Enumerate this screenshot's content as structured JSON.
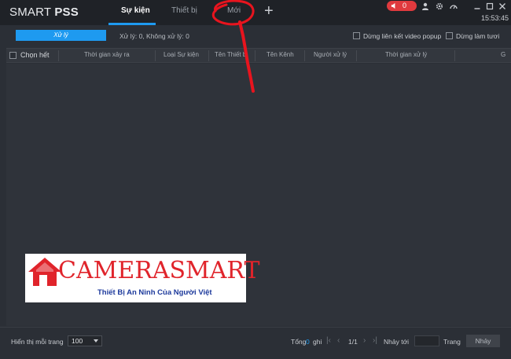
{
  "app": {
    "logo_light": "SMART ",
    "logo_bold": "PSS",
    "clock": "15:53:45",
    "alarm_count": "0"
  },
  "tabs": [
    {
      "label": "Sự kiện",
      "active": true
    },
    {
      "label": "Thiết bị",
      "active": false
    },
    {
      "label": "Mới",
      "active": false
    }
  ],
  "toolbar": {
    "process_label": "Xử lý",
    "process_status": "Xử lý: 0, Không xử lý: 0",
    "popup_label": "Dừng liên kết video popup",
    "refresh_label": "Dừng làm tươi"
  },
  "table": {
    "select_all": "Chọn hết",
    "columns": [
      "Thời gian xảy ra",
      "Loại Sự kiện",
      "Tên Thiết b",
      "Tên Kênh",
      "Người xử lý",
      "Thời gian xử lý",
      "G"
    ]
  },
  "footer": {
    "per_page_label": "Hiển thị mỗi trang",
    "per_page_value": "100",
    "total_label": "Tổng",
    "total_value": "0",
    "total_unit": "ghi",
    "page_indicator": "1/1",
    "goto_label": "Nhảy tới",
    "page_label": "Trang",
    "goto_button": "Nhảy"
  },
  "watermark": {
    "brand": "CAMERASMART",
    "tagline": "Thiết Bị An Ninh Của Người Việt"
  },
  "colors": {
    "accent": "#1e9af0",
    "alarm": "#e03a3e",
    "annotation": "#e8141e",
    "brand_red": "#e0242b",
    "brand_blue": "#1d3a9c"
  }
}
